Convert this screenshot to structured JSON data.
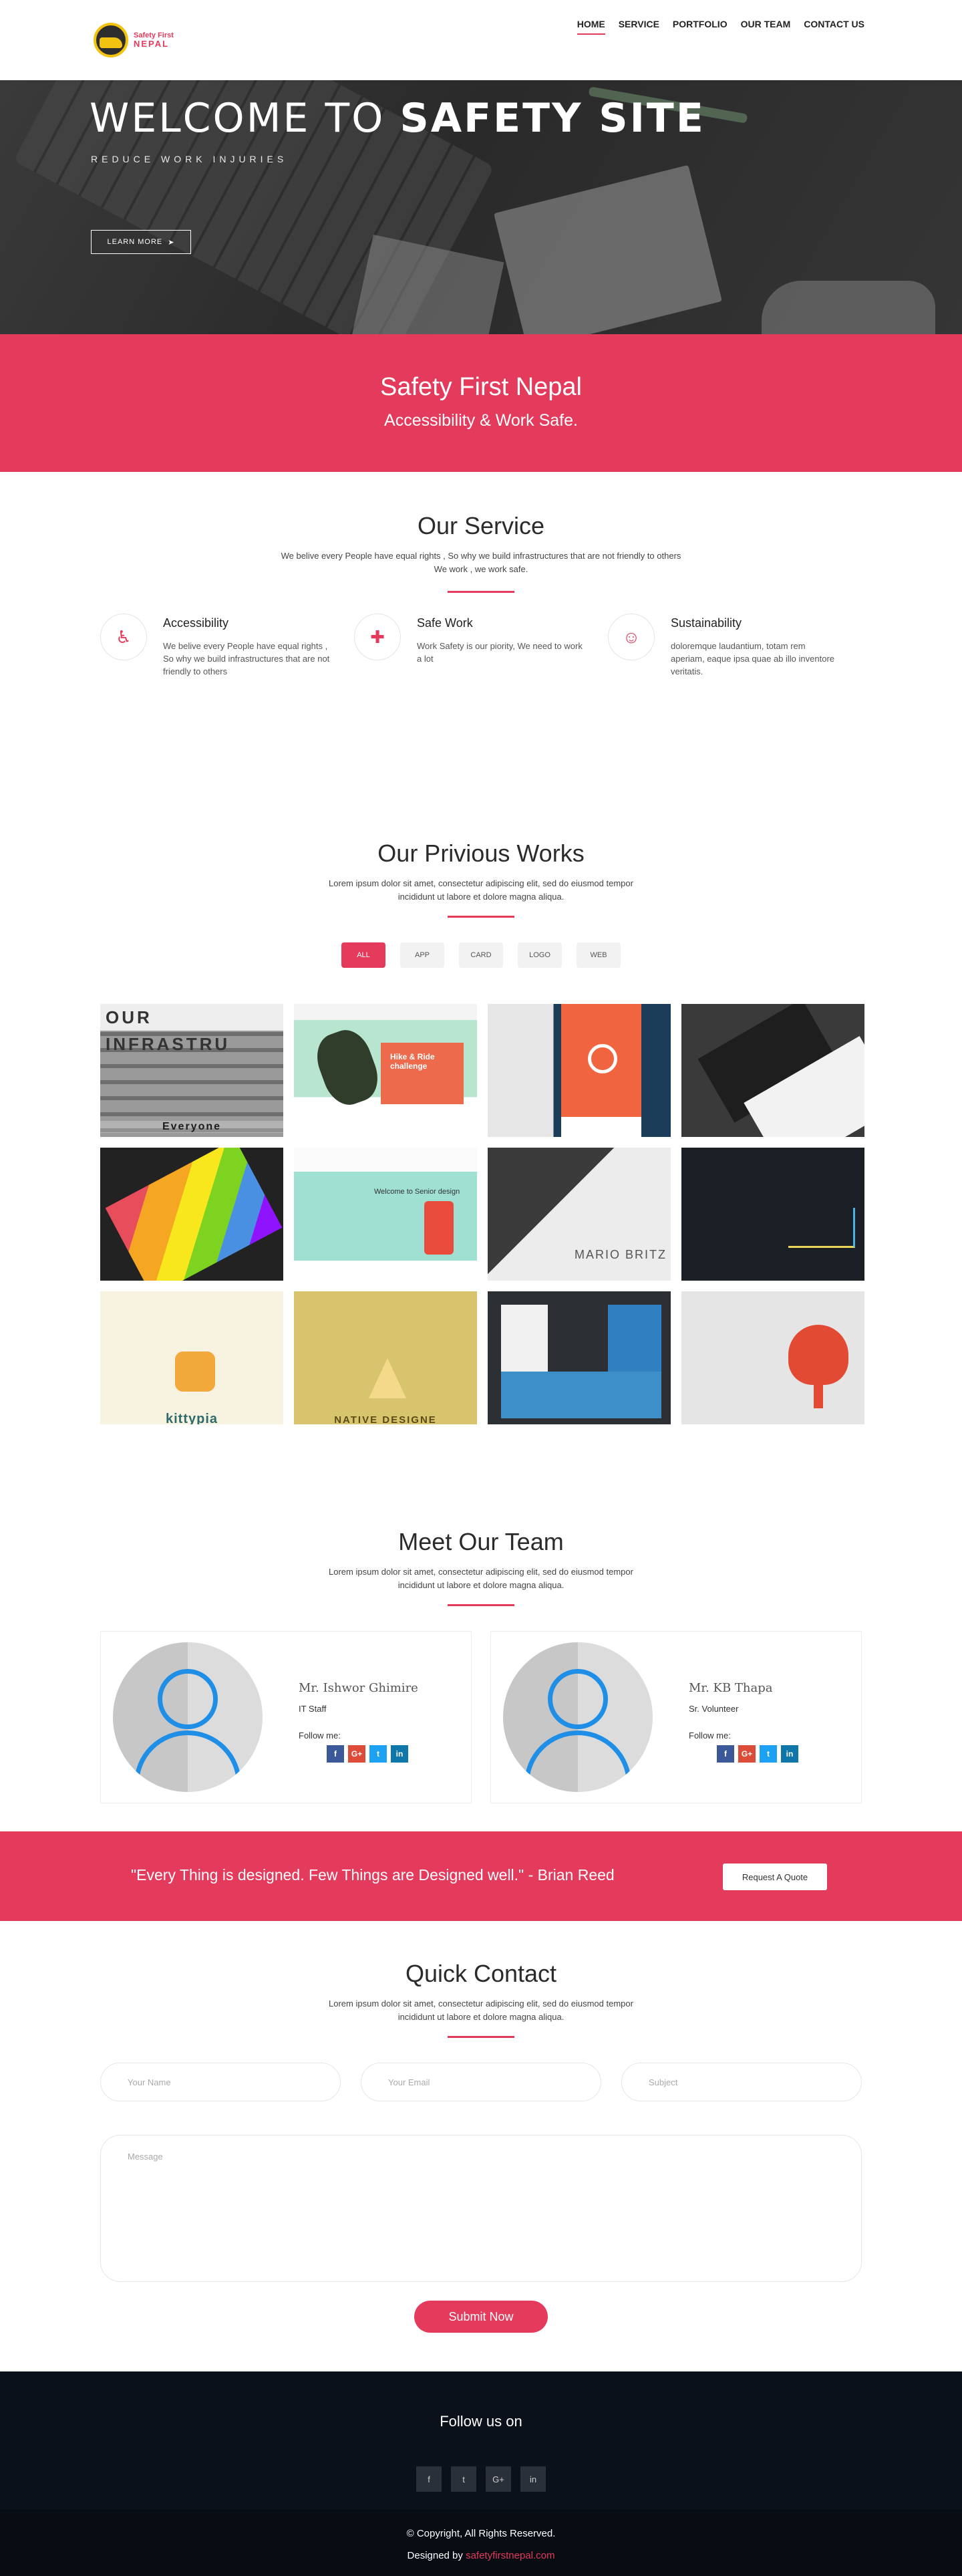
{
  "nav": {
    "logo_line1": "Safety First",
    "logo_line2": "NEPAL",
    "items": [
      {
        "label": "HOME",
        "active": true
      },
      {
        "label": "SERVICE"
      },
      {
        "label": "PORTFOLIO"
      },
      {
        "label": "OUR TEAM"
      },
      {
        "label": "CONTACT US"
      }
    ]
  },
  "hero": {
    "title_light": "WELCOME TO ",
    "title_bold": "SAFETY SITE",
    "subtitle": "REDUCE WORK INJURIES",
    "button": "LEARN MORE"
  },
  "banner": {
    "title": "Safety First Nepal",
    "subtitle": "Accessibility & Work Safe."
  },
  "service": {
    "title": "Our Service",
    "desc_line1": "We belive every People have equal rights , So why we build infrastructures that are not friendly to others",
    "desc_line2": "We work , we work safe.",
    "items": [
      {
        "icon": "wheelchair-icon",
        "glyph": "♿",
        "title": "Accessibility",
        "text": "We belive every People have equal rights , So why we build infrastructures that are not friendly to others"
      },
      {
        "icon": "medkit-icon",
        "glyph": "✚",
        "title": "Safe Work",
        "text": "Work Safety is our piority, We need to work a lot"
      },
      {
        "icon": "smile-icon",
        "glyph": "☺",
        "title": "Sustainability",
        "text": "doloremque laudantium, totam rem aperiam, eaque ipsa quae ab illo inventore veritatis."
      }
    ]
  },
  "works": {
    "title": "Our Privious Works",
    "desc_line1": "Lorem ipsum dolor sit amet, consectetur adipiscing elit, sed do eiusmod tempor",
    "desc_line2": "incididunt ut labore et dolore magna aliqua.",
    "filters": [
      "ALL",
      "APP",
      "CARD",
      "LOGO",
      "WEB"
    ],
    "tile1_top": "OUR INFRASTRU",
    "tile1_label": "Everyone",
    "tile2_text": "Hike & Ride challenge",
    "tile6_text": "Welcome to Senior design",
    "tile7_text": "MARIO BRITZ",
    "tile9_label": "kittypia",
    "tile10_label": "NATIVE DESIGNE"
  },
  "team": {
    "title": "Meet Our Team",
    "desc_line1": "Lorem ipsum dolor sit amet, consectetur adipiscing elit, sed do eiusmod tempor",
    "desc_line2": "incididunt ut labore et dolore magna aliqua.",
    "follow_label": "Follow me:",
    "members": [
      {
        "name": "Mr. Ishwor Ghimire",
        "role": "IT Staff"
      },
      {
        "name": "Mr. KB Thapa",
        "role": "Sr. Volunteer"
      }
    ]
  },
  "quote": {
    "text": "\"Every Thing is designed. Few Things are Designed well.\" - Brian Reed",
    "button": "Request A Quote"
  },
  "contact": {
    "title": "Quick Contact",
    "desc_line1": "Lorem ipsum dolor sit amet, consectetur adipiscing elit, sed do eiusmod tempor",
    "desc_line2": "incididunt ut labore et dolore magna aliqua.",
    "name_placeholder": "Your Name",
    "email_placeholder": "Your Email",
    "subject_placeholder": "Subject",
    "message_placeholder": "Message",
    "submit": "Submit Now"
  },
  "footer": {
    "follow": "Follow us on",
    "social": [
      "f",
      "t",
      "G+",
      "in"
    ],
    "copyright": "© Copyright, All Rights Reserved.",
    "designed_by": "Designed by ",
    "designer": "safetyfirstnepal.com"
  },
  "colors": {
    "accent": "#e43a5b",
    "footer_bg": "#0b111a"
  }
}
